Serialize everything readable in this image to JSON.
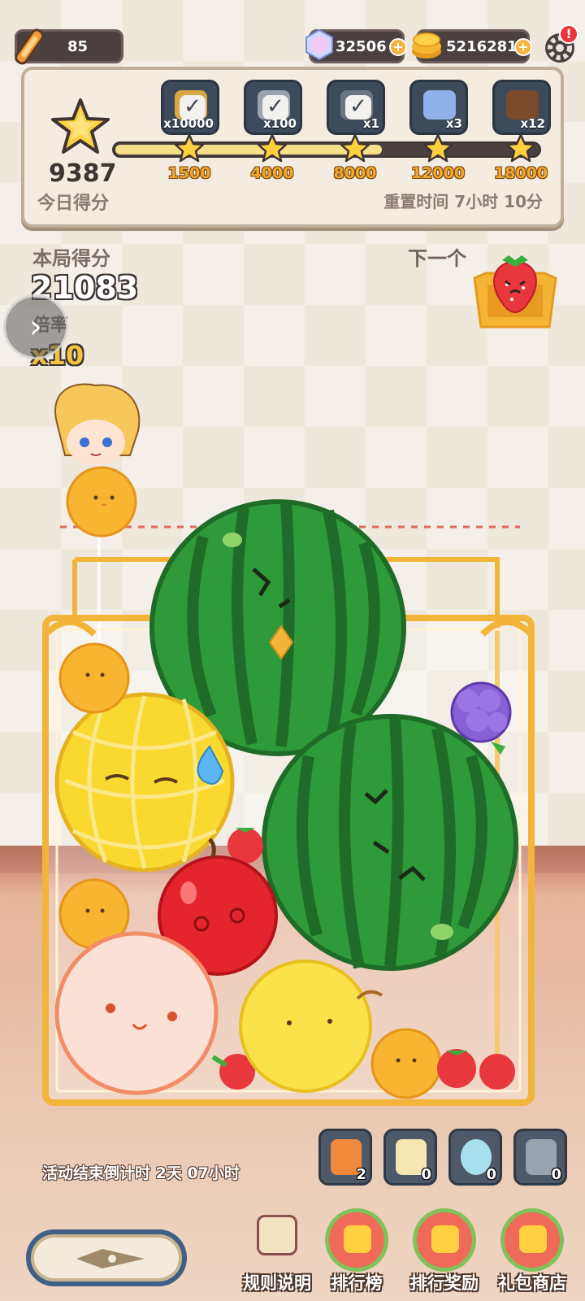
{
  "top_bar": {
    "energy": "85",
    "gems": "32506",
    "gold": "5216281",
    "plus_symbol": "+",
    "settings_badge": "!"
  },
  "daily_panel": {
    "today_score": "9387",
    "today_label": "今日得分",
    "reset_label": "重置时间 7小时 10分",
    "progress_fraction": 0.63,
    "rewards": [
      {
        "icon": "gold-coins-icon",
        "count": "x10000",
        "claimed": true
      },
      {
        "icon": "silver-bars-icon",
        "count": "x100",
        "claimed": true
      },
      {
        "icon": "gem-cube-icon",
        "count": "x1",
        "claimed": true
      },
      {
        "icon": "blue-card-icon",
        "count": "x3",
        "claimed": false
      },
      {
        "icon": "treasure-box-icon",
        "count": "x12",
        "claimed": false
      }
    ],
    "milestones": [
      "1500",
      "4000",
      "8000",
      "12000",
      "18000"
    ]
  },
  "round": {
    "score_label": "本局得分",
    "score": "21083",
    "multiplier_label": "倍率",
    "multiplier": "x10",
    "next_label": "下一个",
    "next_fruit": "strawberry"
  },
  "event": {
    "countdown": "活动结束倒计时 2天 07小时"
  },
  "tools": [
    {
      "icon": "fireworks-icon",
      "count": "2"
    },
    {
      "icon": "star-jar-icon",
      "count": "0"
    },
    {
      "icon": "orb-icon",
      "count": "0"
    },
    {
      "icon": "hammer-icon",
      "count": "0"
    }
  ],
  "menu": [
    {
      "label": "规则说明",
      "icon": "rules-icon"
    },
    {
      "label": "排行榜",
      "icon": "leaderboard-icon"
    },
    {
      "label": "排行奖励",
      "icon": "rank-reward-icon"
    },
    {
      "label": "礼包商店",
      "icon": "gift-shop-icon"
    }
  ],
  "colors": {
    "accent_gold": "#f4c33f",
    "watermelon": "#2f9a3a",
    "frame_gold": "#f2b53a"
  }
}
